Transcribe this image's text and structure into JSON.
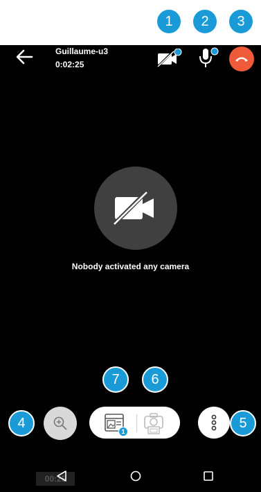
{
  "header": {
    "contact_name": "Guillaume-u3",
    "call_timer": "0:02:25"
  },
  "main": {
    "no_camera_message": "Nobody activated any camera"
  },
  "bottom_nav": {
    "ghost_timer": "00:25"
  },
  "callouts": {
    "c1": "1",
    "c2": "2",
    "c3": "3",
    "c4": "4",
    "c5": "5",
    "c6": "6",
    "c7": "7"
  },
  "badges": {
    "gallery_count": "1"
  },
  "colors": {
    "callout": "#1a9bd7",
    "hangup": "#ef5a3a",
    "background": "#000000"
  },
  "icons": {
    "back": "arrow-left-icon",
    "camera_off": "camera-off-icon",
    "mic": "microphone-icon",
    "hangup": "phone-hangup-icon",
    "zoom": "zoom-in-icon",
    "gallery": "gallery-icon",
    "snapshot": "camera-snapshot-icon",
    "more": "more-vertical-icon",
    "nav_back": "nav-back-icon",
    "nav_home": "nav-home-icon",
    "nav_recents": "nav-recents-icon"
  }
}
